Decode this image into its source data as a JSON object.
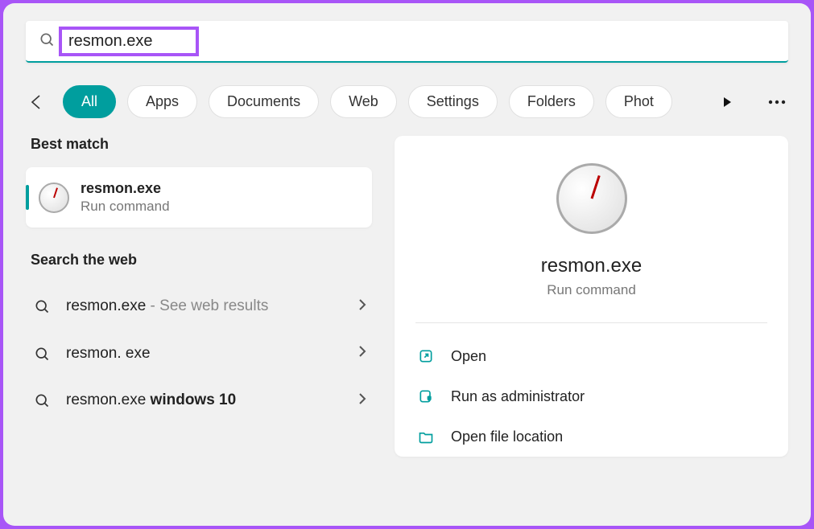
{
  "search": {
    "query": "resmon.exe"
  },
  "filters": {
    "items": [
      "All",
      "Apps",
      "Documents",
      "Web",
      "Settings",
      "Folders",
      "Phot"
    ],
    "active_index": 0
  },
  "sections": {
    "best_match_heading": "Best match",
    "search_web_heading": "Search the web"
  },
  "best_match": {
    "title": "resmon.exe",
    "subtitle": "Run command"
  },
  "web_suggestions": [
    {
      "prefix": "resmon.exe",
      "light": " - See web results",
      "bold": ""
    },
    {
      "prefix": "resmon. exe",
      "light": "",
      "bold": ""
    },
    {
      "prefix": "resmon.exe ",
      "light": "",
      "bold": "windows 10"
    }
  ],
  "details": {
    "title": "resmon.exe",
    "subtitle": "Run command",
    "actions": {
      "open": "Open",
      "run_admin": "Run as administrator",
      "open_location": "Open file location"
    }
  }
}
